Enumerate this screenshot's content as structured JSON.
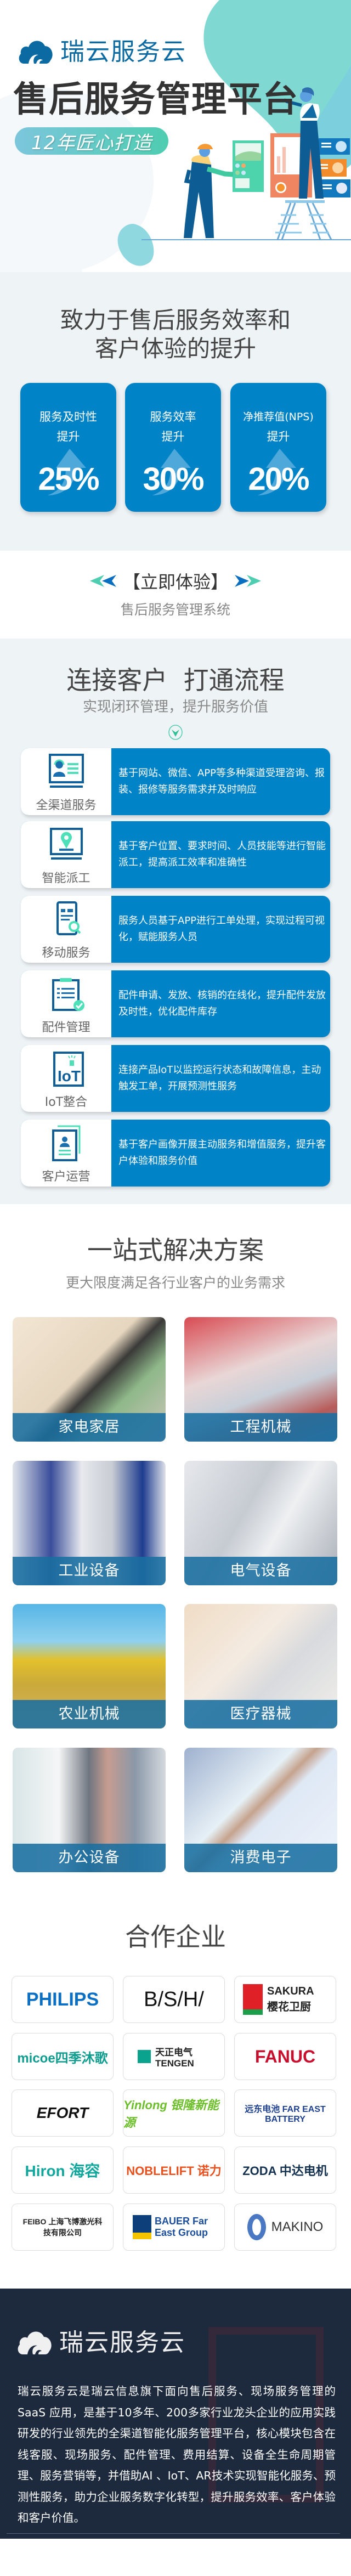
{
  "brand": {
    "name": "瑞云服务云",
    "color": "#0a6aa1",
    "accent": "#4ecdb0"
  },
  "hero": {
    "title": "售后服务管理平台",
    "badge": "12年匠心打造"
  },
  "stats": {
    "title_line1": "致力于售后服务效率和",
    "title_line2": "客户体验的提升",
    "cards": [
      {
        "label1": "服务及时性",
        "label2": "提升",
        "value": "25%"
      },
      {
        "label1": "服务效率",
        "label2": "提升",
        "value": "30%"
      },
      {
        "label1": "净推荐值(NPS)",
        "label2": "提升",
        "value": "20%"
      }
    ],
    "card_color": "#0183c8"
  },
  "cta": {
    "label": "【立即体验】",
    "subtitle": "售后服务管理系统"
  },
  "connect": {
    "title": "连接客户  打通流程",
    "subtitle": "实现闭环管理，提升服务价值",
    "rows": [
      {
        "name": "全渠道服务",
        "icon": "customer-service-icon",
        "desc": "基于网站、微信、APP等多种渠道受理咨询、报装、报修等服务需求并及时响应"
      },
      {
        "name": "智能派工",
        "icon": "location-pin-icon",
        "desc": "基于客户位置、要求时间、人员技能等进行智能派工，提高派工效率和准确性"
      },
      {
        "name": "移动服务",
        "icon": "mobile-search-icon",
        "desc": "服务人员基于APP进行工单处理，实现过程可视化，赋能服务人员"
      },
      {
        "name": "配件管理",
        "icon": "clipboard-check-icon",
        "desc": "配件申请、发放、核销的在线化，提升配件发放及时性，优化配件库存"
      },
      {
        "name": "IoT整合",
        "icon": "iot-icon",
        "desc": "连接产品IoT以监控运行状态和故障信息，主动触发工单，开展预测性服务"
      },
      {
        "name": "客户运营",
        "icon": "customer-profile-icon",
        "desc": "基于客户画像开展主动服务和增值服务，提升客户体验和服务价值"
      }
    ]
  },
  "solutions": {
    "title": "一站式解决方案",
    "subtitle": "更大限度满足各行业客户的业务需求",
    "tiles": [
      {
        "label": "家电家居"
      },
      {
        "label": "工程机械"
      },
      {
        "label": "工业设备"
      },
      {
        "label": "电气设备"
      },
      {
        "label": "农业机械"
      },
      {
        "label": "医疗器械"
      },
      {
        "label": "办公设备"
      },
      {
        "label": "消费电子"
      }
    ]
  },
  "partners": {
    "title": "合作企业",
    "logos": [
      "PHILIPS",
      "B/S/H/",
      "SAKURA 樱花卫厨",
      "micoe四季沐歌",
      "天正电气 TENGEN",
      "FANUC",
      "EFORT",
      "Yinlong 银隆新能源",
      "远东电池 FAR EAST BATTERY",
      "Hiron 海容",
      "NOBLELIFT 诺力",
      "ZODA 中达电机",
      "FEIBO 上海飞博激光科技有限公司",
      "BAUER Far East Group",
      "MAKINO"
    ]
  },
  "footer": {
    "brand": "瑞云服务云",
    "text": "瑞云服务云是瑞云信息旗下面向售后服务、现场服务管理的 SaaS 应用，是基于10多年、200多家行业龙头企业的应用实践研发的行业领先的全渠道智能化服务管理平台，核心模块包含在线客服、现场服务、配件管理、费用结算、设备全生命周期管理、服务营销等，并借助AI 、IoT、AR技术实现智能化服务、预测性服务，助力企业服务数字化转型，提升服务效率、客户体验和客户价值。"
  }
}
